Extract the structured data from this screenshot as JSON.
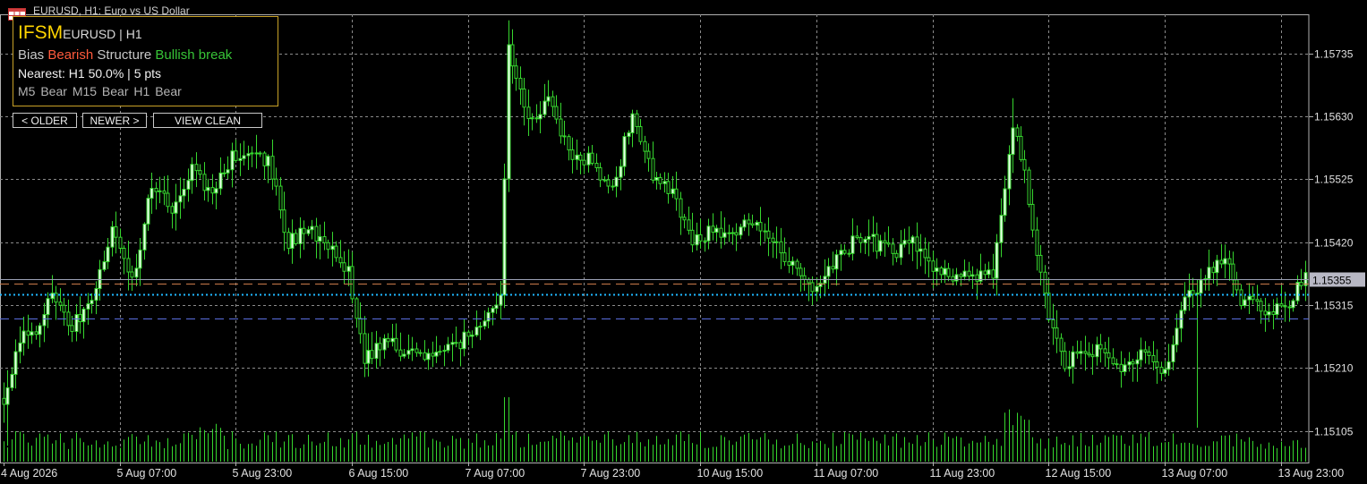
{
  "window": {
    "title": "EURUSD, H1:  Euro vs US Dollar",
    "icon": "chart-window-icon"
  },
  "panel": {
    "brand": "IFSM",
    "symbol_tf": "EURUSD | H1",
    "bias_label": "Bias",
    "bias_value": "Bearish",
    "structure_label": "Structure",
    "structure_value": "Bullish break",
    "nearest": "Nearest: H1 50.0% | 5 pts",
    "tf_m5": "M5 Bear",
    "tf_m15": "M15 Bear",
    "tf_h1": "H1 Bear"
  },
  "buttons": {
    "older": "< OLDER",
    "newer": "NEWER >",
    "view_clean": "VIEW  CLEAN"
  },
  "colors": {
    "background": "#000000",
    "candle": "#36d62e",
    "bull_body": "#e8ffe8",
    "grid": "#8a8a8a",
    "axis_text": "#e0e0e0",
    "price_line": "#9aa0b4",
    "orange_level": "#c97a4a",
    "cyan_level": "#1fb8ff",
    "blue_level": "#5b6fe0",
    "panel_border": "#c9a227",
    "brand": "#ffd400",
    "bearish": "#ff5a3c",
    "bullish": "#37c437"
  },
  "chart_data": {
    "type": "candlestick",
    "symbol": "EURUSD",
    "timeframe": "H1",
    "y_ticks": [
      1.15735,
      1.1563,
      1.15525,
      1.1542,
      1.15315,
      1.1521,
      1.15105
    ],
    "y_tick_labels": [
      "1.15735",
      "1.15630",
      "1.15525",
      "1.15420",
      "1.15315",
      "1.15210",
      "1.15105"
    ],
    "ylim": [
      1.15052,
      1.158
    ],
    "x_tick_labels": [
      "4 Aug 2026",
      "5 Aug 07:00",
      "5 Aug 23:00",
      "6 Aug 15:00",
      "7 Aug 07:00",
      "7 Aug 23:00",
      "10 Aug 15:00",
      "11 Aug 07:00",
      "11 Aug 23:00",
      "12 Aug 15:00",
      "13 Aug 07:00",
      "13 Aug 23:00"
    ],
    "current_price": 1.15355,
    "current_price_label": "1.15355",
    "levels": [
      {
        "price": 1.1535,
        "style": "dashed",
        "color": "#c97a4a"
      },
      {
        "price": 1.15332,
        "style": "dotted",
        "color": "#1fb8ff"
      },
      {
        "price": 1.15292,
        "style": "dashed",
        "color": "#5b6fe0"
      }
    ],
    "grid": true,
    "keyframes": [
      [
        0,
        1.1515
      ],
      [
        4,
        1.1526
      ],
      [
        8,
        1.1527
      ],
      [
        12,
        1.1533
      ],
      [
        17,
        1.1528
      ],
      [
        22,
        1.1532
      ],
      [
        27,
        1.1544
      ],
      [
        32,
        1.1535
      ],
      [
        37,
        1.1552
      ],
      [
        42,
        1.1548
      ],
      [
        47,
        1.1554
      ],
      [
        52,
        1.155
      ],
      [
        57,
        1.1556
      ],
      [
        62,
        1.1556
      ],
      [
        66,
        1.1556
      ],
      [
        71,
        1.1542
      ],
      [
        76,
        1.1544
      ],
      [
        81,
        1.1542
      ],
      [
        86,
        1.1537
      ],
      [
        90,
        1.1522
      ],
      [
        95,
        1.1526
      ],
      [
        100,
        1.1523
      ],
      [
        110,
        1.1524
      ],
      [
        119,
        1.1527
      ],
      [
        124,
        1.1533
      ],
      [
        126,
        1.1574
      ],
      [
        131,
        1.1562
      ],
      [
        136,
        1.1565
      ],
      [
        142,
        1.1556
      ],
      [
        147,
        1.1556
      ],
      [
        152,
        1.155
      ],
      [
        157,
        1.1564
      ],
      [
        162,
        1.1553
      ],
      [
        167,
        1.155
      ],
      [
        172,
        1.1542
      ],
      [
        177,
        1.1544
      ],
      [
        182,
        1.1544
      ],
      [
        187,
        1.1546
      ],
      [
        192,
        1.1542
      ],
      [
        197,
        1.1538
      ],
      [
        202,
        1.1534
      ],
      [
        207,
        1.1538
      ],
      [
        212,
        1.1542
      ],
      [
        217,
        1.1542
      ],
      [
        222,
        1.154
      ],
      [
        227,
        1.1542
      ],
      [
        232,
        1.1538
      ],
      [
        237,
        1.1536
      ],
      [
        242,
        1.1536
      ],
      [
        247,
        1.1537
      ],
      [
        252,
        1.1562
      ],
      [
        255,
        1.1554
      ],
      [
        258,
        1.1539
      ],
      [
        261,
        1.153
      ],
      [
        265,
        1.1522
      ],
      [
        270,
        1.1524
      ],
      [
        275,
        1.1524
      ],
      [
        280,
        1.1521
      ],
      [
        285,
        1.1524
      ],
      [
        290,
        1.152
      ],
      [
        295,
        1.1532
      ],
      [
        300,
        1.1536
      ],
      [
        305,
        1.1539
      ],
      [
        309,
        1.1532
      ],
      [
        315,
        1.1531
      ],
      [
        320,
        1.153
      ],
      [
        325,
        1.1537
      ]
    ]
  }
}
